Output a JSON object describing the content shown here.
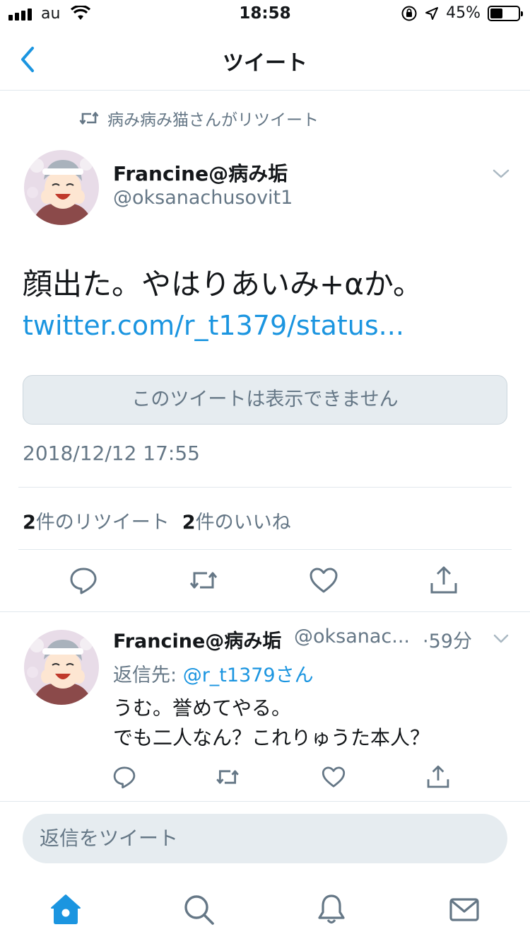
{
  "status_bar": {
    "carrier": "au",
    "time": "18:58",
    "battery": "45%",
    "battery_level": 0.45
  },
  "nav": {
    "title": "ツイート",
    "back_icon": "chevron-left-icon"
  },
  "retweet_context": {
    "text": "病み病み猫さんがリツイート"
  },
  "tweet": {
    "author_name": "Francine@病み垢",
    "author_handle": "@oksanachusovit1",
    "text": "顔出た。やはりあいみ+αか。",
    "link": "twitter.com/r_t1379/status...",
    "unavailable_notice": "このツイートは表示できません",
    "timestamp": "2018/12/12 17:55",
    "retweet_count": "2",
    "retweet_label": "件のリツイート",
    "like_count": "2",
    "like_label": "件のいいね"
  },
  "reply": {
    "author_name": "Francine@病み垢",
    "author_handle": "@oksanac...",
    "time": "·59分",
    "reply_to_label": "返信先:",
    "reply_to_handle": "@r_t1379さん",
    "line1": "うむ。誉めてやる。",
    "line2": "でも二人なん？これりゅうた本人？"
  },
  "composer": {
    "placeholder": "返信をツイート"
  },
  "colors": {
    "accent": "#1b95e0",
    "muted": "#657786",
    "border": "#e1e8ed",
    "field": "#e6ecf0"
  }
}
